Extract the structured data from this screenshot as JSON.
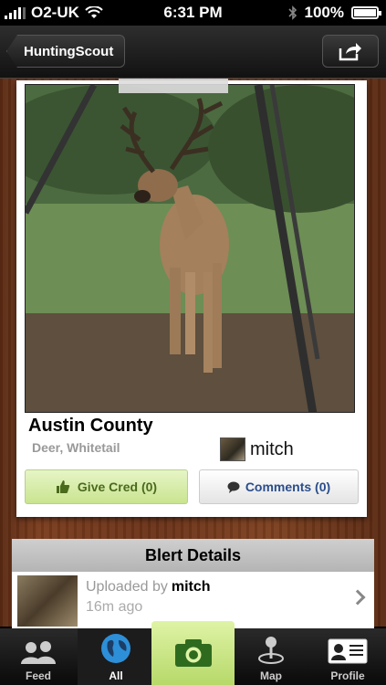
{
  "status": {
    "carrier": "O2-UK",
    "time": "6:31 PM",
    "battery": "100%"
  },
  "nav": {
    "back_label": "HuntingScout"
  },
  "post": {
    "location": "Austin County",
    "species": "Deer, Whitetail",
    "uploader": "mitch",
    "give_cred_label": "Give Cred (0)",
    "comments_label": "Comments (0)"
  },
  "details": {
    "header": "Blert Details",
    "uploaded_by_label": "Uploaded by",
    "uploaded_by_user": "mitch",
    "time_ago": "16m ago"
  },
  "tabs": [
    {
      "label": "Feed",
      "icon": "people-icon"
    },
    {
      "label": "All",
      "icon": "globe-icon",
      "active": true
    },
    {
      "label": "",
      "icon": "camera-icon"
    },
    {
      "label": "Map",
      "icon": "map-pin-icon"
    },
    {
      "label": "Profile",
      "icon": "id-card-icon"
    }
  ]
}
